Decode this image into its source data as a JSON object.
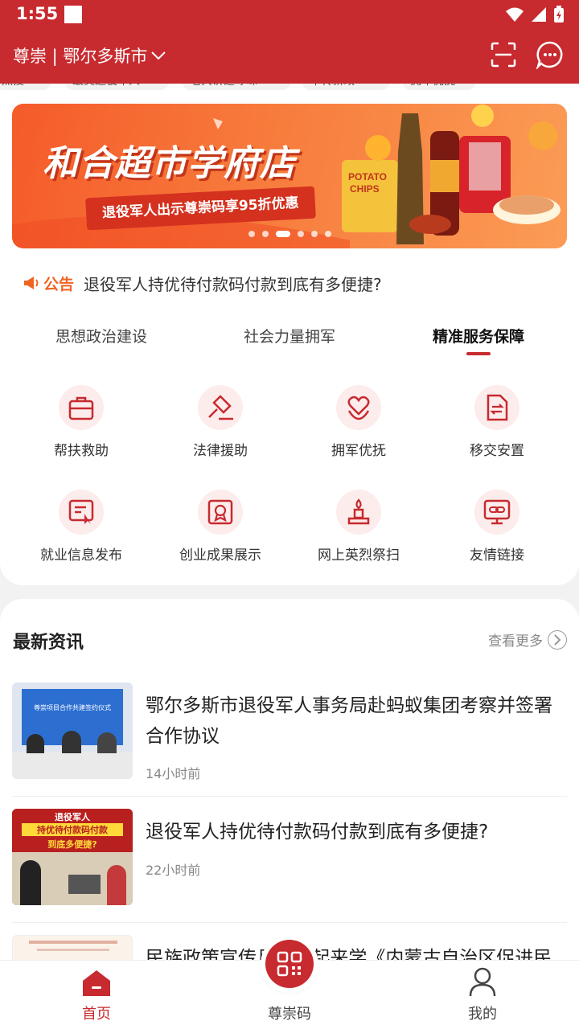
{
  "status_bar": {
    "time": "1:55"
  },
  "header": {
    "city_label": "尊崇 | 鄂尔多斯市"
  },
  "chips": [
    "热搜",
    "最美退役军人",
    "老兵讲述峥嵘",
    "军转新政",
    "拥军优抚"
  ],
  "banner": {
    "title": "和合超市学府店",
    "subtitle": "退役军人出示尊崇码享95折优惠",
    "slide_count": 6,
    "active_slide": 2
  },
  "notice": {
    "tag": "公告",
    "text": "退役军人持优待付款码付款到底有多便捷?"
  },
  "tabs": [
    {
      "label": "思想政治建设",
      "active": false
    },
    {
      "label": "社会力量拥军",
      "active": false
    },
    {
      "label": "精准服务保障",
      "active": true
    }
  ],
  "services": [
    {
      "label": "帮扶救助",
      "icon": "briefcase-icon"
    },
    {
      "label": "法律援助",
      "icon": "gavel-icon"
    },
    {
      "label": "拥军优抚",
      "icon": "heart-hands-icon"
    },
    {
      "label": "移交安置",
      "icon": "transfer-document-icon"
    },
    {
      "label": "就业信息发布",
      "icon": "job-board-icon"
    },
    {
      "label": "创业成果展示",
      "icon": "certificate-icon"
    },
    {
      "label": "网上英烈祭扫",
      "icon": "memorial-candle-icon"
    },
    {
      "label": "友情链接",
      "icon": "link-monitor-icon"
    }
  ],
  "news": {
    "heading": "最新资讯",
    "more_label": "查看更多",
    "items": [
      {
        "title": "鄂尔多斯市退役军人事务局赴蚂蚁集团考察并签署合作协议",
        "time": "14小时前",
        "thumb_caption": "尊崇项目合作共建签约仪式"
      },
      {
        "title": "退役军人持优待付款码付款到底有多便捷?",
        "time": "22小时前",
        "thumb_lines": [
          "退役军人",
          "持优待付款码付款",
          "到底多便捷?"
        ]
      },
      {
        "title": "民族政策宣传月 | 一起来学《内蒙古自治区促进民",
        "time": ""
      }
    ]
  },
  "bottom_nav": [
    {
      "label": "首页",
      "icon": "home-icon",
      "active": true
    },
    {
      "label": "尊崇码",
      "icon": "qr-code-icon",
      "active": false
    },
    {
      "label": "我的",
      "icon": "user-icon",
      "active": false
    }
  ],
  "colors": {
    "brand": "#c72a2f",
    "notice": "#f06423",
    "icon_bg": "#fdecec"
  }
}
